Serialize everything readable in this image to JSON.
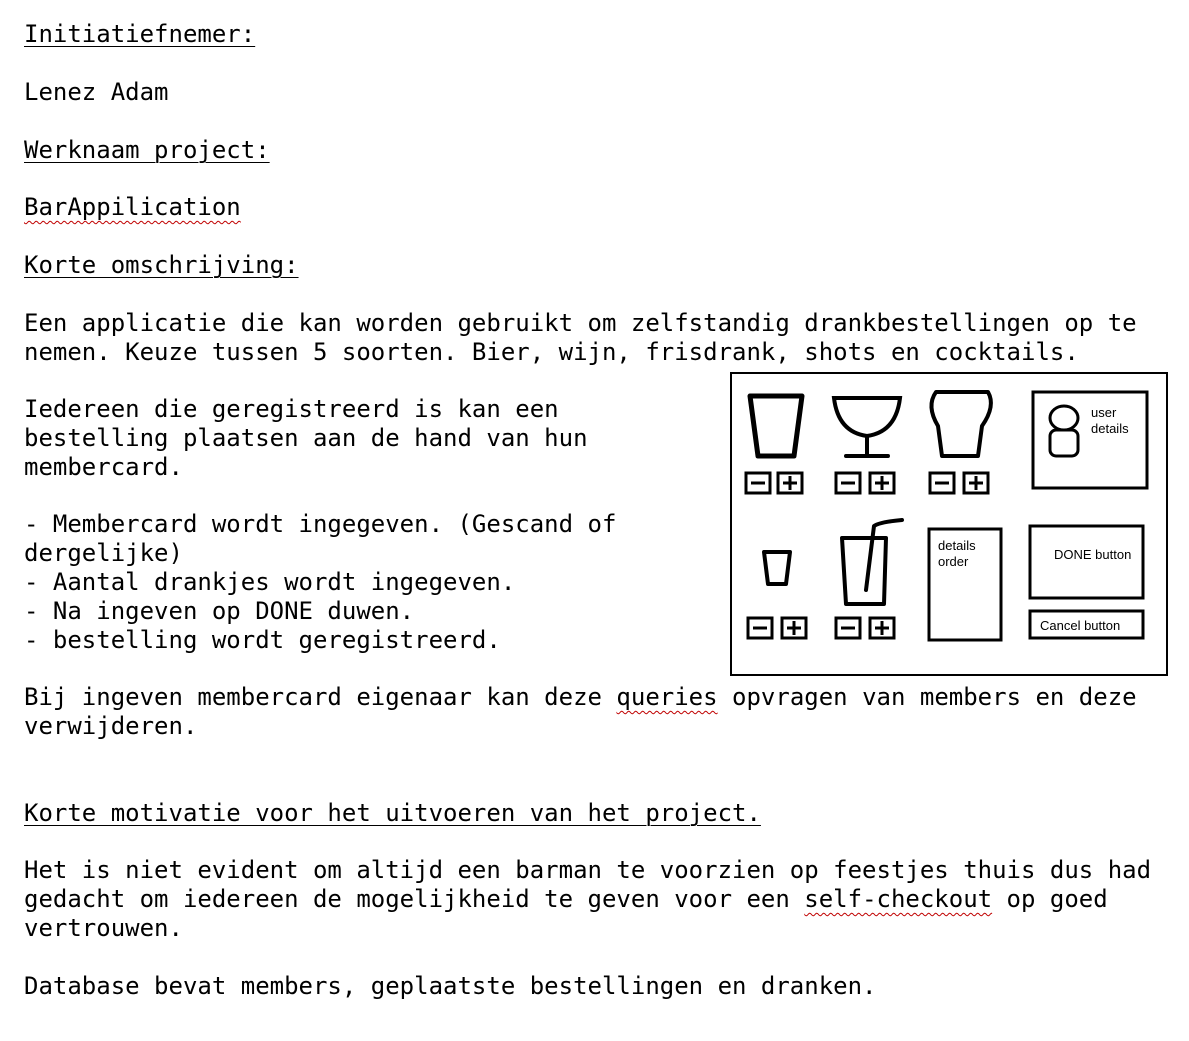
{
  "document": {
    "initiator_heading": "Initiatiefnemer:",
    "initiator_name": "Lenez Adam",
    "project_heading": "Werknaam project:",
    "project_name": "BarAppilication",
    "description_heading": "Korte omschrijving:",
    "description_line1": "Een applicatie die kan worden gebruikt om zelfstandig drankbestellingen op te",
    "description_line2": "nemen. Keuze tussen 5 soorten. Bier, wijn, frisdrank, shots en cocktails.",
    "registered_line1": "Iedereen die geregistreerd is kan een",
    "registered_line2": "bestelling plaatsen aan de hand van hun",
    "registered_line3": "membercard.",
    "step1_line1": "- Membercard wordt ingegeven. (Gescand of",
    "step1_line2": "dergelijke)",
    "step2": "- Aantal drankjes wordt ingegeven.",
    "step3": "- Na ingeven op DONE duwen.",
    "step4": "- bestelling wordt geregistreerd.",
    "owner_line1_a": "Bij ingeven membercard eigenaar kan deze ",
    "owner_line1_b": "queries",
    "owner_line1_c": " opvragen van members en deze",
    "owner_line2": "verwijderen.",
    "motivation_heading": "Korte motivatie voor het uitvoeren van het project.",
    "motivation_line1": "Het is niet evident om altijd een barman te voorzien op feestjes thuis dus had",
    "motivation_line2_a": "gedacht om iedereen de mogelijkheid te geven voor een ",
    "motivation_line2_b": "self-checkout",
    "motivation_line2_c": " op goed",
    "motivation_line3": "vertrouwen.",
    "database_line": "Database bevat members, geplaatste bestellingen en dranken."
  },
  "sketch": {
    "user_details_line1": "user",
    "user_details_line2": "details",
    "details_order_line1": "details",
    "details_order_line2": "order",
    "done_button": "DONE button",
    "cancel_button": "Cancel button",
    "drink_icons": [
      "beer-glass-icon",
      "wine-glass-icon",
      "cocktail-glass-icon",
      "shot-glass-icon",
      "soda-cup-icon"
    ]
  }
}
